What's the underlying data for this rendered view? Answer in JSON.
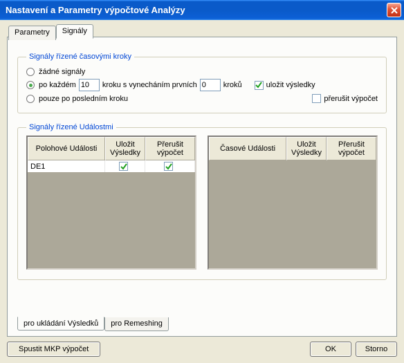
{
  "window": {
    "title": "Nastavení a Parametry výpočtové Analýzy"
  },
  "tabs": {
    "parametry": "Parametry",
    "signaly": "Signály"
  },
  "group_time": {
    "legend": "Signály řízené časovými kroky",
    "opt_none": "žádné signály",
    "opt_every_pre": "po každém",
    "step_value": "10",
    "opt_every_mid": "kroku s vynecháním prvních",
    "skip_value": "0",
    "opt_every_post": "kroků",
    "chk_save": "uložit výsledky",
    "opt_last": "pouze po posledním kroku",
    "chk_interrupt": "přerušit výpočet"
  },
  "group_event": {
    "legend": "Signály řízené Událostmi",
    "left_cols": {
      "c1": "Polohové Události",
      "c2": "Uložit Výsledky",
      "c3": "Přerušit výpočet"
    },
    "right_cols": {
      "c1": "Časové Události",
      "c2": "Uložit Výsledky",
      "c3": "Přerušit výpočet"
    },
    "left_rows": [
      {
        "name": "DE1",
        "save": true,
        "interrupt": true
      }
    ],
    "right_rows": []
  },
  "bottom_tabs": {
    "t1": "pro ukládání Výsledků",
    "t2": "pro Remeshing"
  },
  "buttons": {
    "run": "Spustit MKP výpočet",
    "ok": "OK",
    "cancel": "Storno"
  }
}
